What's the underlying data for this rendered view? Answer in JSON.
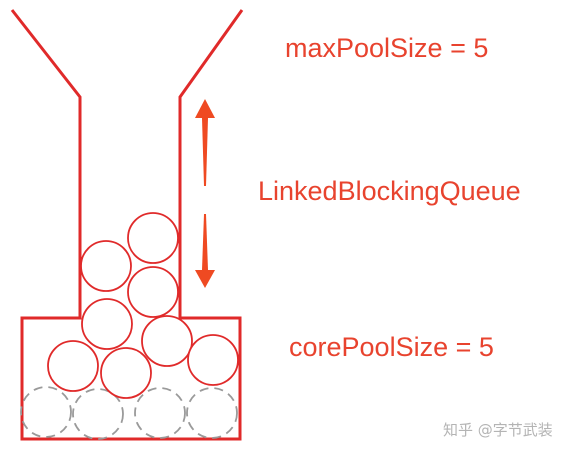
{
  "labels": {
    "max_pool_size": "maxPoolSize = 5",
    "queue": "LinkedBlockingQueue",
    "core_pool_size": "corePoolSize = 5"
  },
  "watermark": "知乎 @字节武装",
  "colors": {
    "accent": "#e8432e",
    "stroke": "#e02a2a",
    "dashed_ball": "#9a9a9a",
    "watermark": "#b4b4b4"
  },
  "icons": {
    "up_arrow": "up-arrow-icon",
    "down_arrow": "down-arrow-icon"
  }
}
